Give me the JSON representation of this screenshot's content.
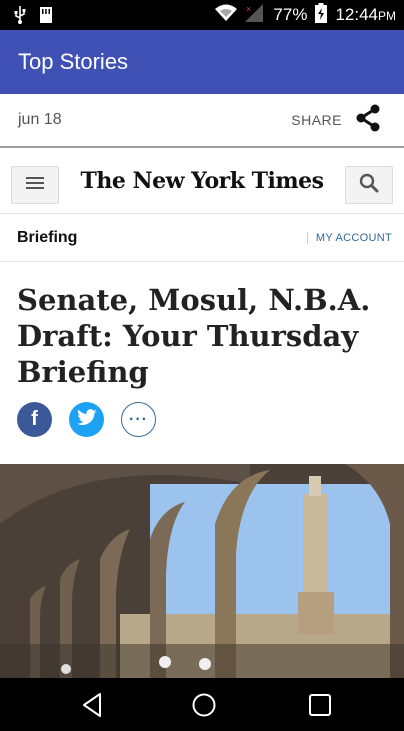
{
  "status_bar": {
    "battery_percent": "77%",
    "time": "12:44",
    "time_suffix": "PM"
  },
  "app_bar": {
    "title": "Top Stories"
  },
  "meta": {
    "date": "jun 18",
    "share_label": "SHARE"
  },
  "article": {
    "masthead": "The New York Times",
    "section": "Briefing",
    "account_link": "MY ACCOUNT",
    "headline": "Senate, Mosul, N.B.A. Draft: Your Thursday Briefing",
    "more_label": "···",
    "facebook_label": "f"
  },
  "icons": {
    "usb": "usb-icon",
    "sd": "sd-card-icon",
    "wifi": "wifi-icon",
    "signal": "signal-icon",
    "battery": "battery-icon",
    "share": "share-icon",
    "menu": "hamburger-menu-icon",
    "search": "search-icon",
    "twitter": "twitter-bird-icon",
    "back": "back-icon",
    "home": "home-icon",
    "recents": "recents-icon"
  },
  "colors": {
    "app_bar": "#3f51b5",
    "facebook": "#3b5998",
    "twitter": "#1da1f2",
    "link": "#326891"
  }
}
